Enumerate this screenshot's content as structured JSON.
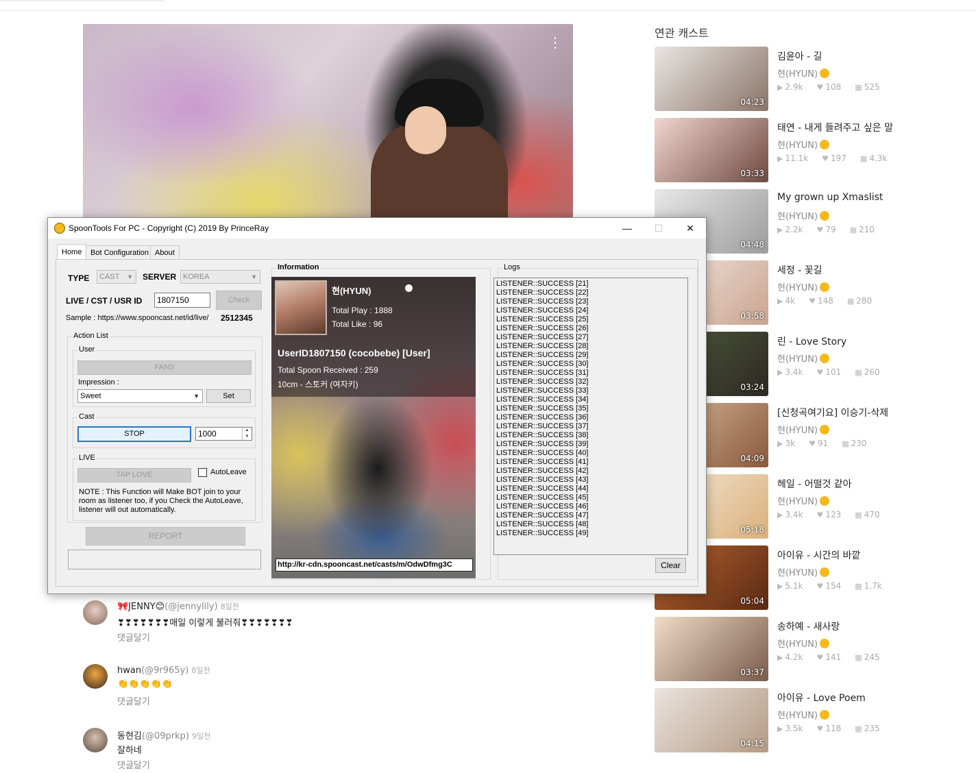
{
  "related": {
    "title": "연관 캐스트",
    "items": [
      {
        "title": "김윤아 - 길",
        "author": "현(HYUN)",
        "plays": "2.9k",
        "likes": "108",
        "gifts": "525",
        "duration": "04:23",
        "c1": "#e9e6e3",
        "c2": "#8a7468"
      },
      {
        "title": "태연 - 내게 들려주고 싶은 말",
        "author": "현(HYUN)",
        "plays": "11.1k",
        "likes": "197",
        "gifts": "4.3k",
        "duration": "03:33",
        "c1": "#f1d6cf",
        "c2": "#6e4a40"
      },
      {
        "title": "My grown up Xmaslist",
        "author": "현(HYUN)",
        "plays": "2.2k",
        "likes": "79",
        "gifts": "210",
        "duration": "04:48",
        "c1": "#e8e8e8",
        "c2": "#9c9c9c"
      },
      {
        "title": "세정 - 꽃길",
        "author": "현(HYUN)",
        "plays": "4k",
        "likes": "148",
        "gifts": "280",
        "duration": "03:58",
        "c1": "#f3e6e0",
        "c2": "#c9a48e"
      },
      {
        "title": "린 - Love Story",
        "author": "현(HYUN)",
        "plays": "3.4k",
        "likes": "101",
        "gifts": "260",
        "duration": "03:24",
        "c1": "#4f5d3a",
        "c2": "#2d2824"
      },
      {
        "title": "[신청곡여기요] 이승기-삭제",
        "author": "현(HYUN)",
        "plays": "3k",
        "likes": "91",
        "gifts": "230",
        "duration": "04:09",
        "c1": "#d9b89a",
        "c2": "#8a5a3c"
      },
      {
        "title": "헤일 - 어떨것 같아",
        "author": "현(HYUN)",
        "plays": "3.4k",
        "likes": "123",
        "gifts": "470",
        "duration": "05:18",
        "c1": "#f5e9d7",
        "c2": "#d9b07c"
      },
      {
        "title": "아이유 - 시간의 바깥",
        "author": "현(HYUN)",
        "plays": "5.1k",
        "likes": "154",
        "gifts": "1.7k",
        "duration": "05:04",
        "c1": "#b6642c",
        "c2": "#5a2a14"
      },
      {
        "title": "송하예 - 새사랑",
        "author": "현(HYUN)",
        "plays": "4.2k",
        "likes": "141",
        "gifts": "245",
        "duration": "03:37",
        "c1": "#f0dcc8",
        "c2": "#7a5c4a"
      },
      {
        "title": "아이유 - Love Poem",
        "author": "현(HYUN)",
        "plays": "3.5k",
        "likes": "118",
        "gifts": "235",
        "duration": "04:15",
        "c1": "#eae4de",
        "c2": "#b49a84"
      }
    ]
  },
  "comments": [
    {
      "name": "🎀JENNY😊",
      "handle": "(@jennylily)",
      "time": "8일전",
      "text": "❣❣❣❣❣❣❣매일 이렇게 불러줘❣❣❣❣❣❣❣",
      "reply": "댓글달기",
      "c1": "#e6cfc4",
      "c2": "#8a6a5c"
    },
    {
      "name": "hwan",
      "handle": "(@9r965y)",
      "time": "8일전",
      "text": "👏👏👏👏👏",
      "reply": "댓글달기",
      "c1": "#f0a640",
      "c2": "#3a2a20"
    },
    {
      "name": "동현김",
      "handle": "(@09prkp)",
      "time": "9일전",
      "text": "잘하네",
      "reply": "댓글달기",
      "c1": "#d8c0b0",
      "c2": "#5a4a40"
    }
  ],
  "window": {
    "title": "SpoonTools For PC - Copyright (C) 2019 By PrinceRay",
    "minimize": "—",
    "maximize": "☐",
    "close": "✕",
    "tabs": [
      "Home",
      "Bot Configuration",
      "About"
    ],
    "type_label": "TYPE",
    "type_value": "CAST",
    "server_label": "SERVER",
    "server_value": "KOREA",
    "id_label": "LIVE / CST / USR ID",
    "id_value": "1807150",
    "check_label": "Check",
    "sample_label": "Sample : https://www.spooncast.net/id/live/",
    "sample_value": "2512345",
    "action_list": "Action List",
    "user_group": "User",
    "fans_label": "FANS",
    "impression_label": "Impression :",
    "impression_value": "Sweet",
    "set_label": "Set",
    "cast_group": "Cast",
    "stop_label": "STOP",
    "cast_number": "1000",
    "live_group": "LIVE",
    "tap_love_label": "TAP LOVE",
    "autoleave_label": "AutoLeave",
    "note_lines": [
      "NOTE : This Function will Make BOT join to your",
      "room as listener too, if you Check the AutoLeave,",
      "listener will out automatically."
    ],
    "report_label": "REPORT",
    "information_label": "Information",
    "info": {
      "name": "현(HYUN)",
      "total_play": "Total Play : 1888",
      "total_like": "Total Like : 96",
      "user_line": "UserID1807150 (cocobebe) [User]",
      "spoon_received": "Total Spoon Received : 259",
      "subtitle": "10cm - 스토커 (여자키)",
      "url": "http://kr-cdn.spooncast.net/casts/m/OdwDfmg3C"
    },
    "logs_label": "Logs",
    "logs": [
      "LISTENER::SUCCESS [21]",
      "LISTENER::SUCCESS [22]",
      "LISTENER::SUCCESS [23]",
      "LISTENER::SUCCESS [24]",
      "LISTENER::SUCCESS [25]",
      "LISTENER::SUCCESS [26]",
      "LISTENER::SUCCESS [27]",
      "LISTENER::SUCCESS [28]",
      "LISTENER::SUCCESS [29]",
      "LISTENER::SUCCESS [30]",
      "LISTENER::SUCCESS [31]",
      "LISTENER::SUCCESS [32]",
      "LISTENER::SUCCESS [33]",
      "LISTENER::SUCCESS [34]",
      "LISTENER::SUCCESS [35]",
      "LISTENER::SUCCESS [36]",
      "LISTENER::SUCCESS [37]",
      "LISTENER::SUCCESS [38]",
      "LISTENER::SUCCESS [39]",
      "LISTENER::SUCCESS [40]",
      "LISTENER::SUCCESS [41]",
      "LISTENER::SUCCESS [42]",
      "LISTENER::SUCCESS [43]",
      "LISTENER::SUCCESS [44]",
      "LISTENER::SUCCESS [45]",
      "LISTENER::SUCCESS [46]",
      "LISTENER::SUCCESS [47]",
      "LISTENER::SUCCESS [48]",
      "LISTENER::SUCCESS [49]"
    ],
    "clear_label": "Clear"
  }
}
